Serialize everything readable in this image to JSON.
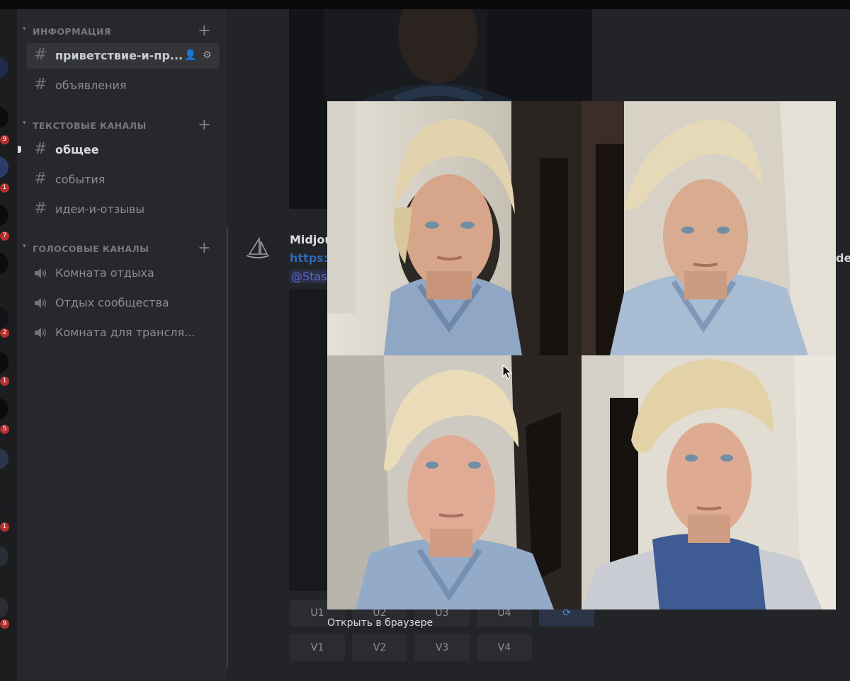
{
  "sidebar": {
    "categories": [
      {
        "label": "ИНФОРМАЦИЯ",
        "channels": [
          {
            "name": "приветствие-и-пр..."
          },
          {
            "name": "объявления"
          }
        ]
      },
      {
        "label": "ТЕКСТОВЫЕ КАНАЛЫ",
        "channels": [
          {
            "name": "общее"
          },
          {
            "name": "события"
          },
          {
            "name": "идеи-и-отзывы"
          }
        ]
      },
      {
        "label": "ГОЛОСОВЫЕ КАНАЛЫ",
        "channels": [
          {
            "name": "Комната отдыха"
          },
          {
            "name": "Отдых сообщества"
          },
          {
            "name": "Комната для трансля..."
          }
        ]
      }
    ]
  },
  "server_badges": [
    "9",
    "1",
    "7",
    "2",
    "1",
    "5",
    "1",
    "9"
  ],
  "chat": {
    "author": "Midjou",
    "link": "https:",
    "mention": "@Stas",
    "side_text": "de",
    "upscale_buttons": [
      "U1",
      "U2",
      "U3",
      "U4"
    ],
    "variation_buttons": [
      "V1",
      "V2",
      "V3",
      "V4"
    ]
  },
  "viewer": {
    "open_in_browser": "Открыть в браузере"
  },
  "colors": {
    "background": "#222326",
    "sidebar": "#27282b",
    "badge": "#b3312f",
    "link": "#2f67b8",
    "mention": "#5b68c9"
  }
}
